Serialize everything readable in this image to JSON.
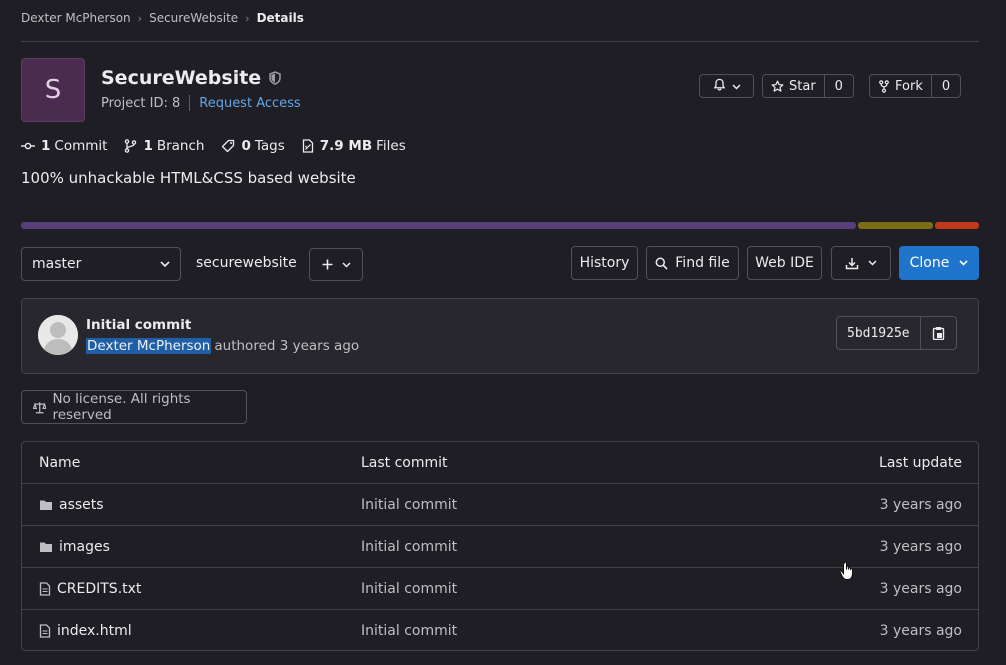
{
  "breadcrumb": {
    "items": [
      "Dexter McPherson",
      "SecureWebsite",
      "Details"
    ]
  },
  "project": {
    "avatar_letter": "S",
    "name": "SecureWebsite",
    "id_text": "Project ID: 8",
    "request_access": "Request Access",
    "description": "100% unhackable HTML&CSS based website"
  },
  "actions": {
    "star_label": "Star",
    "star_count": "0",
    "fork_label": "Fork",
    "fork_count": "0"
  },
  "stats": {
    "commits_num": "1",
    "commits_label": "Commit",
    "branches_num": "1",
    "branches_label": "Branch",
    "tags_num": "0",
    "tags_label": "Tags",
    "files_num": "7.9 MB",
    "files_label": "Files"
  },
  "language_bar": {
    "segments": [
      {
        "color": "#563d7c",
        "fraction": 0.874
      },
      {
        "color": "#7b6d15",
        "fraction": 0.08
      },
      {
        "color": "#c0391a",
        "fraction": 0.046
      }
    ]
  },
  "toolbar": {
    "branch": "master",
    "path": "securewebsite",
    "path_sep": "/",
    "history": "History",
    "find_file": "Find file",
    "web_ide": "Web IDE",
    "clone": "Clone"
  },
  "commit": {
    "title": "Initial commit",
    "author": "Dexter McPherson",
    "authored": "authored 3 years ago",
    "sha": "5bd1925e"
  },
  "license": {
    "label": "No license. All rights reserved"
  },
  "table": {
    "headers": {
      "name": "Name",
      "last_commit": "Last commit",
      "last_update": "Last update"
    },
    "rows": [
      {
        "name": "assets",
        "type": "folder",
        "commit": "Initial commit",
        "updated": "3 years ago"
      },
      {
        "name": "images",
        "type": "folder",
        "commit": "Initial commit",
        "updated": "3 years ago"
      },
      {
        "name": "CREDITS.txt",
        "type": "file",
        "commit": "Initial commit",
        "updated": "3 years ago"
      },
      {
        "name": "index.html",
        "type": "file",
        "commit": "Initial commit",
        "updated": "3 years ago"
      }
    ]
  }
}
